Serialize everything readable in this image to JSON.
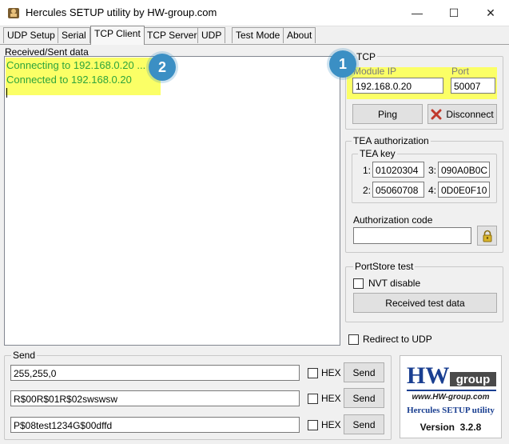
{
  "window": {
    "title": "Hercules SETUP utility by HW-group.com",
    "minimize": "—",
    "maximize": "☐",
    "close": "✕"
  },
  "tabs": [
    "UDP Setup",
    "Serial",
    "TCP Client",
    "TCP Server",
    "UDP",
    "Test Mode",
    "About"
  ],
  "received": {
    "label": "Received/Sent data",
    "lines": [
      "Connecting to 192.168.0.20 ...",
      "Connected to 192.168.0.20"
    ]
  },
  "tcp": {
    "group": "TCP",
    "module_ip_label": "Module IP",
    "module_ip": "192.168.0.20",
    "port_label": "Port",
    "port": "50007",
    "ping": "Ping",
    "disconnect": "Disconnect"
  },
  "tea": {
    "group": "TEA authorization",
    "key_group": "TEA key",
    "keys": [
      {
        "n": "1:",
        "v": "01020304"
      },
      {
        "n": "3:",
        "v": "090A0B0C"
      },
      {
        "n": "2:",
        "v": "05060708"
      },
      {
        "n": "4:",
        "v": "0D0E0F10"
      }
    ],
    "auth_label": "Authorization code",
    "auth_value": ""
  },
  "portstore": {
    "group": "PortStore test",
    "nvt": "NVT disable",
    "received_test": "Received test data"
  },
  "redirect": "Redirect to UDP",
  "send": {
    "group": "Send",
    "hex": "HEX",
    "button": "Send",
    "rows": [
      "255,255,0",
      "R$00R$01R$02swswsw",
      "P$08test1234G$00dffd"
    ]
  },
  "logo": {
    "hw": "HW",
    "group": "group",
    "url": "www.HW-group.com",
    "product": "Hercules SETUP utility",
    "version": "Version  3.2.8"
  },
  "annotations": {
    "badge1": "1",
    "badge2": "2"
  },
  "colors": {
    "accent_badge": "#3b8fc4",
    "highlight": "#fbff66",
    "recv_text": "#2ea43c",
    "disconnect_x": "#c0392b",
    "logo_blue": "#1a3f91"
  }
}
